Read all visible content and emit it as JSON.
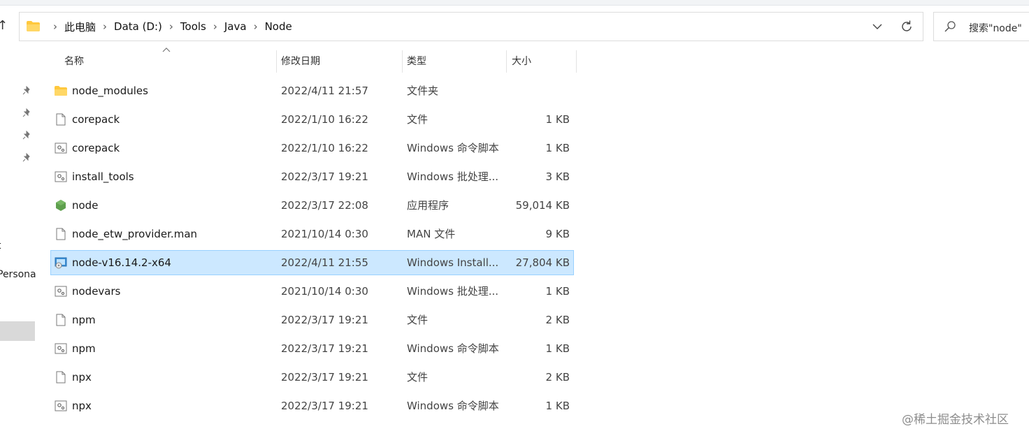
{
  "address_bar": {
    "breadcrumbs": [
      "此电脑",
      "Data (D:)",
      "Tools",
      "Java",
      "Node"
    ]
  },
  "search": {
    "placeholder": "搜索\"node\""
  },
  "nav_pane": {
    "partial_labels": [
      "t",
      "Persona"
    ]
  },
  "columns": {
    "name": "名称",
    "date": "修改日期",
    "type": "类型",
    "size": "大小"
  },
  "files": [
    {
      "name": "node_modules",
      "date": "2022/4/11 21:57",
      "type": "文件夹",
      "size": "",
      "icon": "folder-icon",
      "selected": false
    },
    {
      "name": "corepack",
      "date": "2022/1/10 16:22",
      "type": "文件",
      "size": "1 KB",
      "icon": "blank-file-icon",
      "selected": false
    },
    {
      "name": "corepack",
      "date": "2022/1/10 16:22",
      "type": "Windows 命令脚本",
      "size": "1 KB",
      "icon": "script-file-icon",
      "selected": false
    },
    {
      "name": "install_tools",
      "date": "2022/3/17 19:21",
      "type": "Windows 批处理...",
      "size": "3 KB",
      "icon": "script-file-icon",
      "selected": false
    },
    {
      "name": "node",
      "date": "2022/3/17 22:08",
      "type": "应用程序",
      "size": "59,014 KB",
      "icon": "nodejs-app-icon",
      "selected": false
    },
    {
      "name": "node_etw_provider.man",
      "date": "2021/10/14 0:30",
      "type": "MAN 文件",
      "size": "9 KB",
      "icon": "blank-file-icon",
      "selected": false
    },
    {
      "name": "node-v16.14.2-x64",
      "date": "2022/4/11 21:55",
      "type": "Windows Install...",
      "size": "27,804 KB",
      "icon": "installer-icon",
      "selected": true
    },
    {
      "name": "nodevars",
      "date": "2021/10/14 0:30",
      "type": "Windows 批处理...",
      "size": "1 KB",
      "icon": "script-file-icon",
      "selected": false
    },
    {
      "name": "npm",
      "date": "2022/3/17 19:21",
      "type": "文件",
      "size": "2 KB",
      "icon": "blank-file-icon",
      "selected": false
    },
    {
      "name": "npm",
      "date": "2022/3/17 19:21",
      "type": "Windows 命令脚本",
      "size": "1 KB",
      "icon": "script-file-icon",
      "selected": false
    },
    {
      "name": "npx",
      "date": "2022/3/17 19:21",
      "type": "文件",
      "size": "2 KB",
      "icon": "blank-file-icon",
      "selected": false
    },
    {
      "name": "npx",
      "date": "2022/3/17 19:21",
      "type": "Windows 命令脚本",
      "size": "1 KB",
      "icon": "script-file-icon",
      "selected": false
    }
  ],
  "watermark": "@稀土掘金技术社区",
  "colors": {
    "selection_bg": "#cce8ff",
    "selection_border": "#99d1ff",
    "folder": "#ffc83d",
    "node_green": "#5fa04e"
  }
}
